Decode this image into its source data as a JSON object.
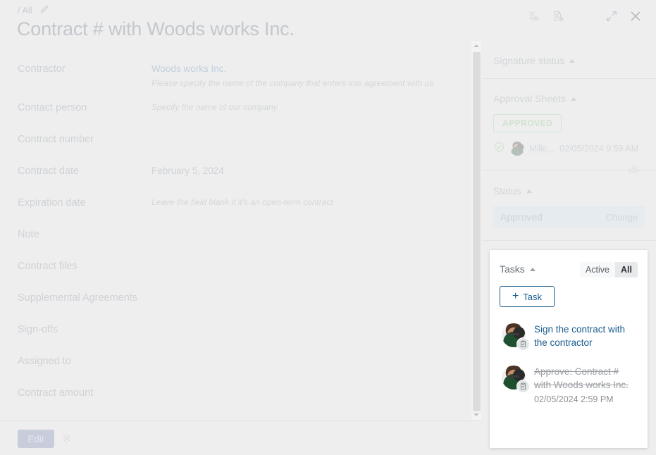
{
  "breadcrumb": {
    "path": "/ All",
    "edit_icon": "pencil-icon"
  },
  "header": {
    "title": "Contract # with Woods works Inc.",
    "icons": [
      {
        "name": "bell-off-icon",
        "label": "Notifications off"
      },
      {
        "name": "document-add-icon",
        "label": "Add document"
      },
      {
        "name": "expand-icon",
        "label": "Expand"
      },
      {
        "name": "close-icon",
        "label": "Close"
      }
    ]
  },
  "form": {
    "fields": [
      {
        "label": "Contractor",
        "value": "Woods works Inc.",
        "is_link": true,
        "hint": "Please specify the name of the company that enters into agreement with us"
      },
      {
        "label": "Contact person",
        "value": "",
        "hint": "Specify the name of our company"
      },
      {
        "label": "Contract number",
        "value": "",
        "hint": ""
      },
      {
        "label": "Contract date",
        "value": "February 5, 2024",
        "hint": ""
      },
      {
        "label": "Expiration date",
        "value": "",
        "hint": "Leave the field blank if it's an open-term contract"
      },
      {
        "label": "Note",
        "value": "",
        "hint": ""
      },
      {
        "label": "Contract files",
        "value": "",
        "hint": ""
      },
      {
        "label": "Supplemental Agreements",
        "value": "",
        "hint": ""
      },
      {
        "label": "Sign-offs",
        "value": "",
        "hint": ""
      },
      {
        "label": "Assigned to",
        "value": "",
        "hint": ""
      },
      {
        "label": "Contract amount",
        "value": "",
        "hint": ""
      }
    ]
  },
  "bottom_bar": {
    "edit_label": "Edit",
    "settings_icon": "gear-icon"
  },
  "sidebar": {
    "signature_status": {
      "title": "Signature status"
    },
    "approval_sheets": {
      "title": "Approval Sheets",
      "badge": "APPROVED",
      "download_icon": "download-icon",
      "approver": {
        "status_icon": "check-circle-icon",
        "name": "Mille...",
        "date": "02/05/2024 9:59 AM"
      }
    },
    "status": {
      "title": "Status",
      "value": "Approved",
      "change_label": "Change"
    }
  },
  "tasks": {
    "title": "Tasks",
    "filters": [
      {
        "label": "Active",
        "active": false
      },
      {
        "label": "All",
        "active": true
      }
    ],
    "add_label": "Task",
    "items": [
      {
        "text": "Sign the contract with the contractor",
        "completed": false,
        "date": "",
        "badge_icon": "clipboard-check-icon"
      },
      {
        "text": "Approve: Contract # with Woods works Inc.",
        "completed": true,
        "date": "02/05/2024 2:59 PM",
        "badge_icon": "clipboard-check-icon"
      }
    ]
  },
  "colors": {
    "page_bg": "#eeeeee",
    "accent_blue": "#1b5e8f",
    "approved_green": "#cfe3cf",
    "dim_text": "#cfd2d6",
    "status_bar_bg": "#e6ebef"
  }
}
